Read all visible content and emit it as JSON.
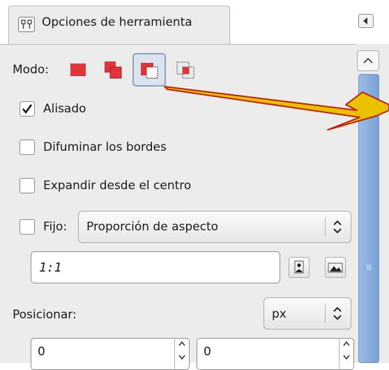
{
  "colors": {
    "arrow": "#e8c200",
    "arrow_edge": "#c0200a",
    "mode_red": "#e0343a",
    "scroll_thumb": "#85aadb"
  },
  "tab": {
    "icon": "tool-options-icon",
    "label": "Opciones de herramienta",
    "menu_icon": "tab-menu-icon"
  },
  "mode": {
    "label": "Modo:",
    "buttons": [
      "replace-selection-icon",
      "add-to-selection-icon",
      "subtract-from-selection-icon",
      "intersect-with-selection-icon"
    ],
    "active_index": 2
  },
  "antialias": {
    "label": "Alisado",
    "checked": true
  },
  "feather": {
    "label": "Difuminar los bordes",
    "checked": false
  },
  "expand": {
    "label": "Expandir desde el centro",
    "checked": false
  },
  "fixed": {
    "label": "Fijo:",
    "checked": false,
    "combo_value": "Proporción de aspecto"
  },
  "ratio": {
    "value": "1:1",
    "portrait_icon": "portrait-icon",
    "landscape_icon": "landscape-icon"
  },
  "position": {
    "label": "Posicionar:",
    "unit": "px",
    "x": "0",
    "y": "0"
  }
}
